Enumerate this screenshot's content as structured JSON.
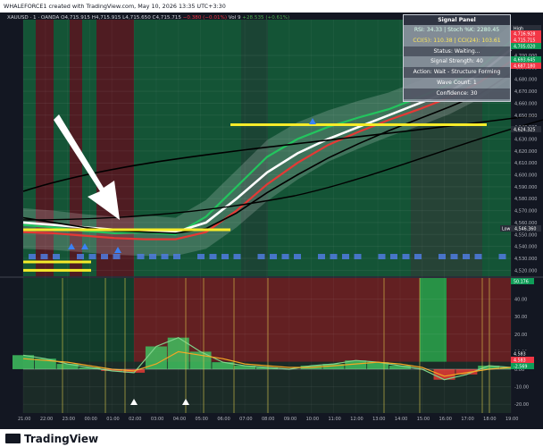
{
  "header": {
    "caption": "WHALEFORCE1 created with TradingView.com, May 10, 2026 13:35 UTC+3:30"
  },
  "legend": {
    "symbol": "XAUUSD · 1 · OANDA",
    "ohlc": "O4,715.915  H4,715.915  L4,715.650  C4,715.715",
    "change": "−0.380 (−0.01%)",
    "volume_label": "Vol 9",
    "extra": "+28.535 (+0.61%)"
  },
  "signal_panel": {
    "title": "Signal Panel",
    "rsi_line": "RSI: 34.33 | Stoch %K: 2280.45",
    "cci_line": "CCI(5): 110.38 | CCI(24): 103.61",
    "status": "Status: Waiting...",
    "strength": "Signal Strength: 40",
    "action": "Action: Wait - Structure Forming",
    "wave_count": "Wave Count: 1",
    "confidence": "Confidence: 30"
  },
  "price_labels": {
    "high_tag": "High",
    "low_tag": "Low",
    "tag1": "4,716.928",
    "tag2": "4,715.715",
    "tag3": "4,705.020",
    "tag4": "4,693.645",
    "tag5": "4,687.180",
    "tag6": "4,624.325",
    "low_value": "4,546.360"
  },
  "colors": {
    "background": "#131722",
    "green_zone": "#155f3a",
    "red_zone": "#5a1d22",
    "bullish": "#22c55e",
    "bearish": "#e53935",
    "yellow_level": "#f5eb2a",
    "arrow": "#ffffff"
  },
  "chart_data": [
    {
      "type": "line",
      "title": "",
      "x": [
        "21:00",
        "22:00",
        "23:00",
        "00:00",
        "01:00",
        "02:00",
        "03:00",
        "04:00",
        "05:00",
        "06:00",
        "07:00",
        "08:00",
        "09:00",
        "10:00",
        "11:00",
        "12:00",
        "13:00"
      ],
      "series": [
        {
          "values": [
            4558,
            4556,
            4553,
            4551,
            4552,
            4550,
            4565,
            4590,
            4615,
            4630,
            4640,
            4648,
            4655,
            4665,
            4676,
            4690,
            4712
          ]
        },
        {
          "values": [
            4560,
            4558,
            4556,
            4554,
            4553,
            4552,
            4560,
            4580,
            4602,
            4618,
            4630,
            4640,
            4650,
            4660,
            4670,
            4685,
            4705
          ]
        },
        {
          "values": [
            4552,
            4551,
            4549,
            4547,
            4546,
            4546,
            4552,
            4570,
            4592,
            4610,
            4625,
            4636,
            4646,
            4655,
            4665,
            4678,
            4695
          ]
        },
        {
          "values": [
            4564,
            4560,
            4556,
            4553,
            4552,
            4551,
            4555,
            4568,
            4585,
            4600,
            4614,
            4626,
            4637,
            4647,
            4657,
            4668,
            4685
          ]
        }
      ],
      "levels": [
        4642,
        4554,
        4527,
        4520
      ],
      "y_ticks": [
        4700,
        4690,
        4680,
        4670,
        4660,
        4650,
        4640,
        4630,
        4620,
        4610,
        4600,
        4590,
        4580,
        4570,
        4560,
        4550,
        4540,
        4530,
        4520
      ],
      "ylim": [
        4515,
        4730
      ],
      "grid": true
    },
    {
      "type": "area",
      "title": "",
      "x": [
        "21:00",
        "22:00",
        "23:00",
        "00:00",
        "01:00",
        "02:00",
        "03:00",
        "04:00",
        "05:00",
        "06:00",
        "07:00",
        "08:00",
        "09:00",
        "10:00",
        "11:00",
        "12:00",
        "13:00",
        "14:00",
        "15:00",
        "16:00",
        "17:00",
        "18:00",
        "19:00"
      ],
      "series": [
        {
          "values": [
            8,
            6,
            3,
            1,
            -1,
            -2,
            13,
            18,
            10,
            4,
            2,
            1,
            0,
            2,
            3,
            5,
            4,
            2,
            0,
            -6,
            -3,
            2,
            1
          ]
        },
        {
          "values": [
            6,
            5,
            4,
            2,
            0,
            -1,
            3,
            10,
            8,
            6,
            3,
            2,
            1,
            1,
            2,
            3,
            4,
            3,
            1,
            -4,
            -2,
            0,
            1
          ]
        }
      ],
      "y_ticks": [
        40,
        30,
        20,
        10,
        0,
        -10,
        -20
      ],
      "value_labels": [
        "50.176",
        "4.583",
        "4.583",
        "-2.569"
      ],
      "ylim": [
        -25,
        52
      ],
      "grid": true
    }
  ]
}
